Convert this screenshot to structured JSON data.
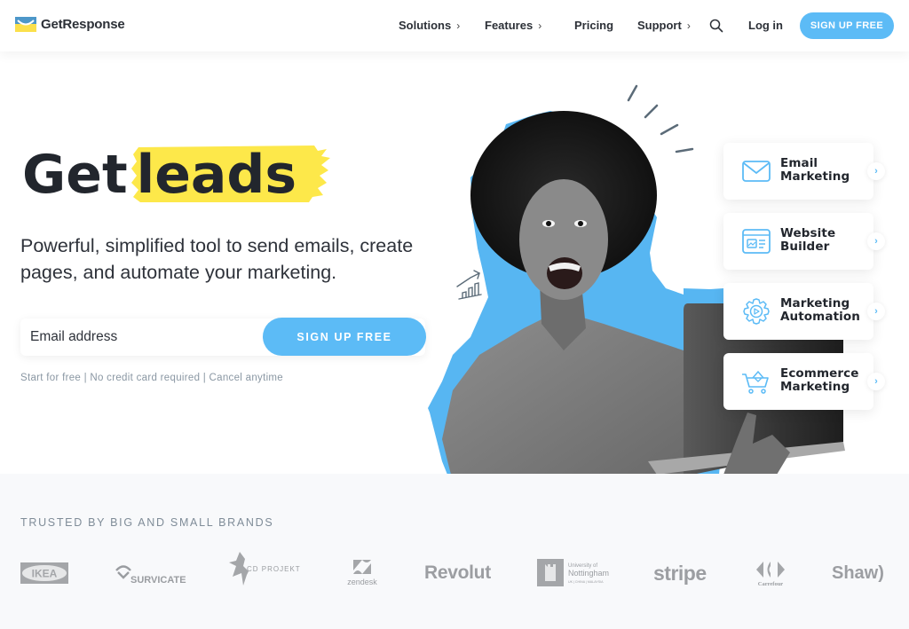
{
  "header": {
    "brand": "GetResponse",
    "nav": [
      {
        "label": "Solutions",
        "has_submenu": true
      },
      {
        "label": "Features",
        "has_submenu": true
      },
      {
        "label": "Pricing",
        "has_submenu": false
      },
      {
        "label": "Support",
        "has_submenu": true
      }
    ],
    "chevron": "›",
    "search_icon": "search-icon",
    "login_label": "Log in",
    "signup_label": "SIGN UP FREE"
  },
  "hero": {
    "title_word1": "Get",
    "title_word2": "leads",
    "subtitle": "Powerful, simplified tool to send emails, create pages, and automate your marketing.",
    "email_placeholder": "Email address",
    "email_value": "",
    "signup_label": "SIGN UP FREE",
    "fine_print": "Start for free | No credit card required | Cancel anytime"
  },
  "features": [
    {
      "line1": "Email",
      "line2": "Marketing",
      "icon": "envelope-icon"
    },
    {
      "line1": "Website",
      "line2": "Builder",
      "icon": "browser-window-icon"
    },
    {
      "line1": "Marketing",
      "line2": "Automation",
      "icon": "gear-play-icon"
    },
    {
      "line1": "Ecommerce",
      "line2": "Marketing",
      "icon": "shopping-cart-icon"
    }
  ],
  "feature_arrow": "›",
  "trusted": {
    "title": "TRUSTED BY BIG AND SMALL BRANDS",
    "brands": [
      {
        "name": "IKEA"
      },
      {
        "name": "SURVICATE"
      },
      {
        "name": "CD PROJEKT"
      },
      {
        "name": "zendesk"
      },
      {
        "name": "Revolut"
      },
      {
        "name": "University of Nottingham",
        "line1": "University of",
        "line2": "Nottingham",
        "line3": "UK | CHINA | MALAYSIA"
      },
      {
        "name": "stripe"
      },
      {
        "name": "Carrefour"
      },
      {
        "name": "Shaw)"
      }
    ]
  },
  "colors": {
    "accent_blue": "#5cbbf6",
    "highlight_yellow": "#fde84a",
    "text_dark": "#22262d",
    "muted": "#8a97a3"
  }
}
